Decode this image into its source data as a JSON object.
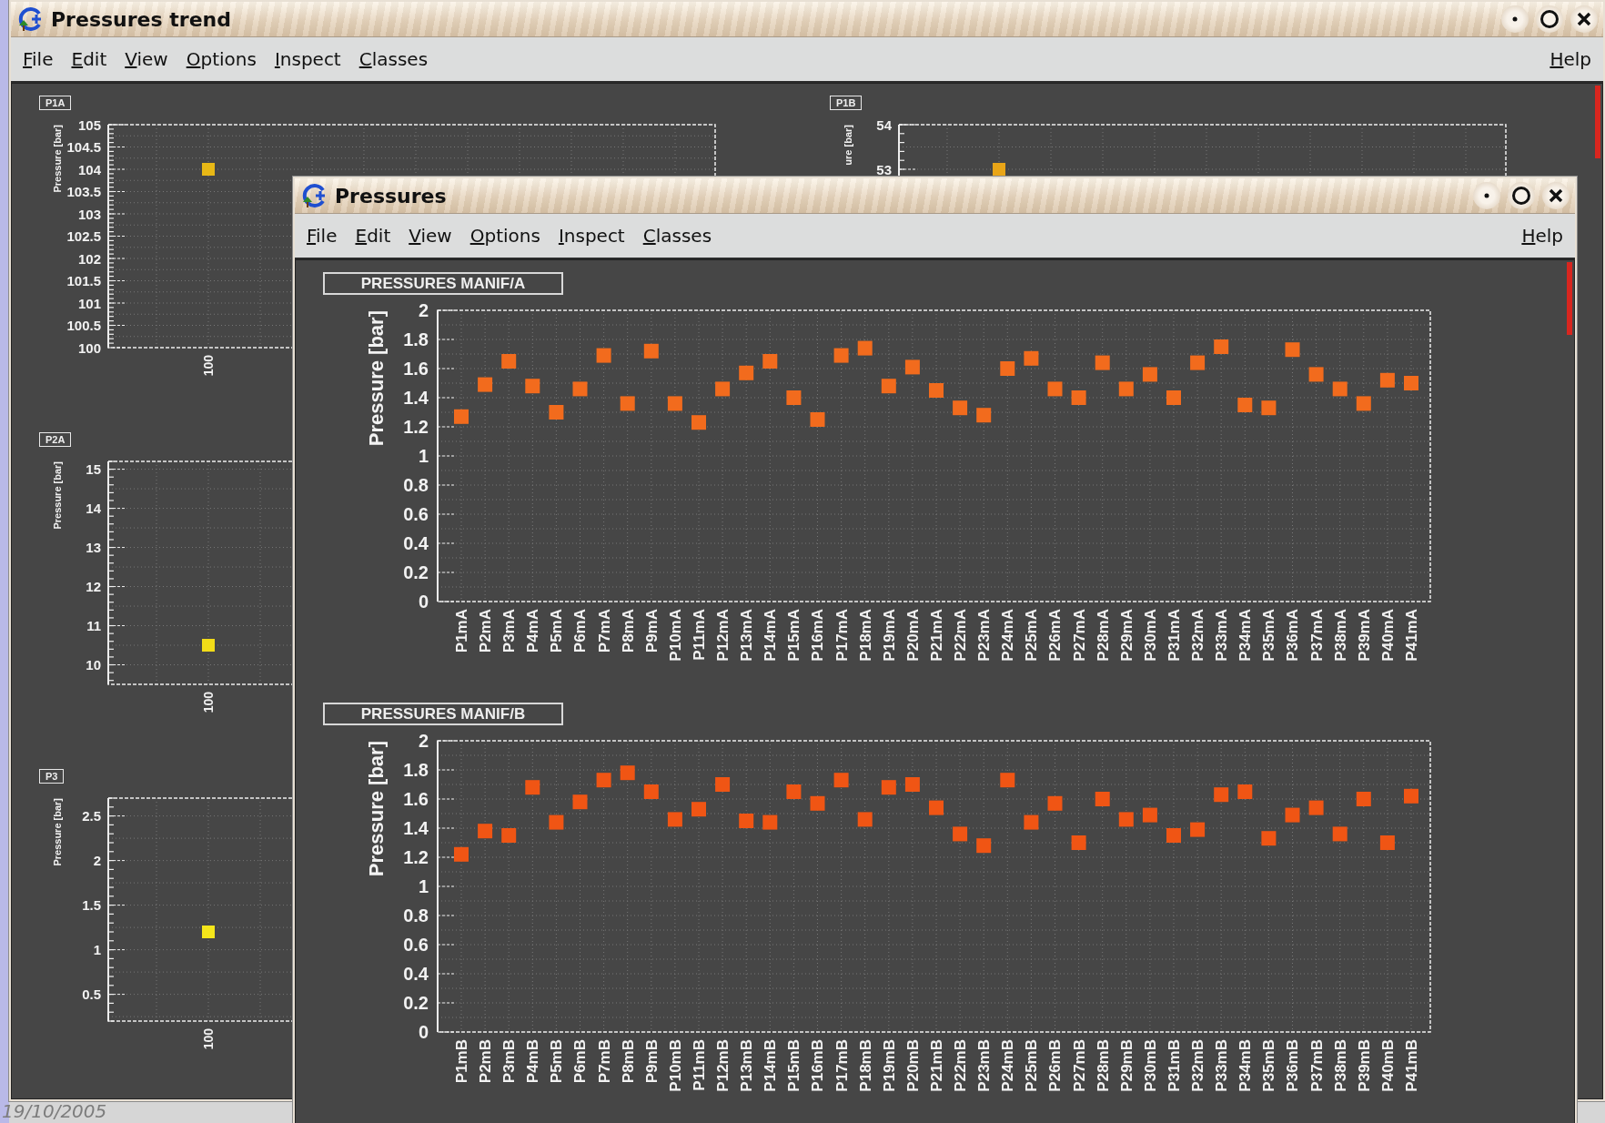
{
  "desktop": {
    "date": "19/10/2005"
  },
  "trend_window": {
    "title": "Pressures trend",
    "menu": [
      "File",
      "Edit",
      "View",
      "Options",
      "Inspect",
      "Classes"
    ],
    "help": "Help",
    "plot_columns": [
      [
        {
          "chart_data": {
            "type": "scatter",
            "title": "P1A",
            "ylabel": "Pressure [bar]",
            "categories": [
              "100"
            ],
            "series": [
              {
                "color": "#e8b816",
                "values": [
                  104
                ]
              }
            ],
            "ylim": [
              100,
              105
            ],
            "yticks": [
              100,
              100.5,
              101,
              101.5,
              102,
              102.5,
              103,
              103.5,
              104,
              104.5,
              105
            ],
            "grid": true
          }
        },
        {
          "chart_data": {
            "type": "scatter",
            "title": "P2A",
            "ylabel": "Pressure [bar]",
            "categories": [
              "100"
            ],
            "series": [
              {
                "color": "#f2dc18",
                "values": [
                  10.5
                ]
              }
            ],
            "ylim": [
              9.5,
              15.2
            ],
            "yticks": [
              10,
              11,
              12,
              13,
              14,
              15
            ],
            "grid": true
          }
        },
        {
          "chart_data": {
            "type": "scatter",
            "title": "P3",
            "ylabel": "Pressure [bar]",
            "categories": [
              "100"
            ],
            "series": [
              {
                "color": "#f5e61a",
                "values": [
                  1.2
                ]
              }
            ],
            "ylim": [
              0.2,
              2.7
            ],
            "yticks": [
              0.5,
              1,
              1.5,
              2,
              2.5
            ],
            "grid": true
          }
        }
      ],
      [
        {
          "chart_data": {
            "type": "scatter",
            "title": "P1B",
            "ylabel": "ure [bar]",
            "series": [
              {
                "color": "#e9a517",
                "values": [
                  53
                ]
              }
            ],
            "ylim": [
              49,
              54
            ],
            "yticks": [
              53,
              54
            ],
            "grid": true
          }
        }
      ]
    ]
  },
  "pressures_window": {
    "title": "Pressures",
    "menu": [
      "File",
      "Edit",
      "View",
      "Options",
      "Inspect",
      "Classes"
    ],
    "help": "Help",
    "plots": [
      {
        "chart_data": {
          "type": "scatter",
          "title": "PRESSURES MANIF/A",
          "ylabel": "Pressure [bar]",
          "categories": [
            "P1mA",
            "P2mA",
            "P3mA",
            "P4mA",
            "P5mA",
            "P6mA",
            "P7mA",
            "P8mA",
            "P9mA",
            "P10mA",
            "P11mA",
            "P12mA",
            "P13mA",
            "P14mA",
            "P15mA",
            "P16mA",
            "P17mA",
            "P18mA",
            "P19mA",
            "P20mA",
            "P21mA",
            "P22mA",
            "P23mA",
            "P24mA",
            "P25mA",
            "P26mA",
            "P27mA",
            "P28mA",
            "P29mA",
            "P30mA",
            "P31mA",
            "P32mA",
            "P33mA",
            "P34mA",
            "P35mA",
            "P36mA",
            "P37mA",
            "P38mA",
            "P39mA",
            "P40mA",
            "P41mA"
          ],
          "series": [
            {
              "color": "#f26b1d",
              "values": [
                1.27,
                1.49,
                1.65,
                1.48,
                1.3,
                1.46,
                1.69,
                1.36,
                1.72,
                1.36,
                1.23,
                1.46,
                1.57,
                1.65,
                1.4,
                1.25,
                1.69,
                1.74,
                1.48,
                1.61,
                1.45,
                1.33,
                1.28,
                1.6,
                1.67,
                1.46,
                1.4,
                1.64,
                1.46,
                1.56,
                1.4,
                1.64,
                1.75,
                1.35,
                1.33,
                1.73,
                1.56,
                1.46,
                1.36,
                1.52,
                1.5
              ]
            }
          ],
          "ylim": [
            0,
            2
          ],
          "yticks": [
            0,
            0.2,
            0.4,
            0.6,
            0.8,
            1,
            1.2,
            1.4,
            1.6,
            1.8,
            2
          ],
          "grid": true
        }
      },
      {
        "chart_data": {
          "type": "scatter",
          "title": "PRESSURES MANIF/B",
          "ylabel": "Pressure [bar]",
          "categories": [
            "P1mB",
            "P2mB",
            "P3mB",
            "P4mB",
            "P5mB",
            "P6mB",
            "P7mB",
            "P8mB",
            "P9mB",
            "P10mB",
            "P11mB",
            "P12mB",
            "P13mB",
            "P14mB",
            "P15mB",
            "P16mB",
            "P17mB",
            "P18mB",
            "P19mB",
            "P20mB",
            "P21mB",
            "P22mB",
            "P23mB",
            "P24mB",
            "P25mB",
            "P26mB",
            "P27mB",
            "P28mB",
            "P29mB",
            "P30mB",
            "P31mB",
            "P32mB",
            "P33mB",
            "P34mB",
            "P35mB",
            "P36mB",
            "P37mB",
            "P38mB",
            "P39mB",
            "P40mB",
            "P41mB"
          ],
          "series": [
            {
              "color": "#f05514",
              "values": [
                1.22,
                1.38,
                1.35,
                1.68,
                1.44,
                1.58,
                1.73,
                1.78,
                1.65,
                1.46,
                1.53,
                1.7,
                1.45,
                1.44,
                1.65,
                1.57,
                1.73,
                1.46,
                1.68,
                1.7,
                1.54,
                1.36,
                1.28,
                1.73,
                1.44,
                1.57,
                1.3,
                1.6,
                1.46,
                1.49,
                1.35,
                1.39,
                1.63,
                1.65,
                1.33,
                1.49,
                1.54,
                1.36,
                1.6,
                1.3,
                1.62
              ]
            }
          ],
          "ylim": [
            0,
            2
          ],
          "yticks": [
            0,
            0.2,
            0.4,
            0.6,
            0.8,
            1,
            1.2,
            1.4,
            1.6,
            1.8,
            2
          ],
          "grid": true
        }
      }
    ]
  }
}
